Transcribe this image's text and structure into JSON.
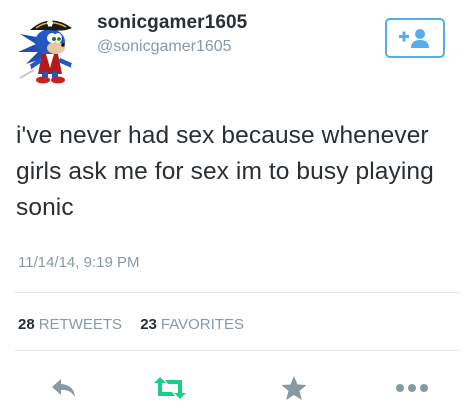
{
  "tweet": {
    "display_name": "sonicgamer1605",
    "handle": "@sonicgamer1605",
    "text": "i've never had sex because whenever girls ask me for sex im to busy playing sonic",
    "timestamp": "11/14/14, 9:19 PM"
  },
  "stats": {
    "retweets_count": "28",
    "retweets_label": "RETWEETS",
    "favorites_count": "23",
    "favorites_label": "FAVORITES"
  },
  "follow_button": {
    "icon": "add-user-icon",
    "color": "#55acee"
  },
  "actions": {
    "reply_icon": "reply-icon",
    "retweet_icon": "retweet-icon",
    "favorite_icon": "star-icon",
    "more_icon": "more-icon"
  },
  "colors": {
    "text": "#292f33",
    "secondary": "#8899a6",
    "accent": "#55acee",
    "retweet": "#19cf86",
    "divider": "#e1e8ed"
  }
}
